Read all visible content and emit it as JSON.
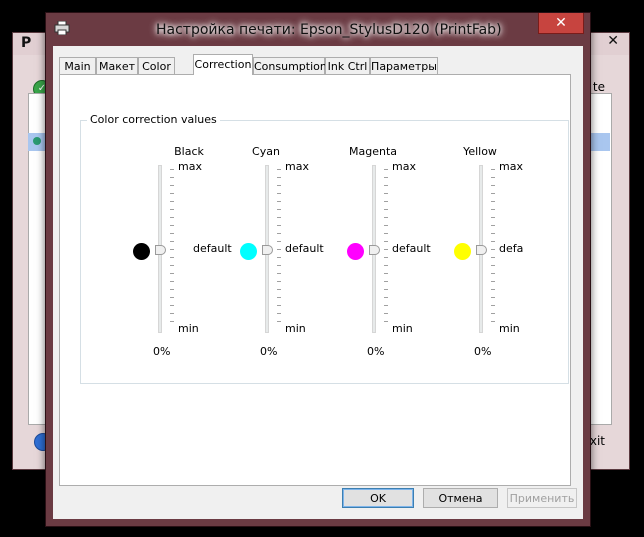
{
  "background_window": {
    "logo": "P",
    "close": "✕",
    "right_top_text": "te",
    "right_bottom_text": "xit"
  },
  "dialog": {
    "title": "Настройка печати: Epson_StylusD120 (PrintFab)",
    "close": "✕"
  },
  "tabs": [
    {
      "label": "Main"
    },
    {
      "label": "Макет"
    },
    {
      "label": "Color"
    },
    {
      "label": "Correction",
      "active": true
    },
    {
      "label": "Consumption"
    },
    {
      "label": "Ink Ctrl"
    },
    {
      "label": "Параметры"
    }
  ],
  "group": {
    "label": "Color correction values"
  },
  "channels": [
    {
      "name": "Black",
      "color": "#000000",
      "max": "max",
      "default": "default",
      "min": "min",
      "value": "0%"
    },
    {
      "name": "Cyan",
      "color": "#00ffff",
      "max": "max",
      "default": "default",
      "min": "min",
      "value": "0%"
    },
    {
      "name": "Magenta",
      "color": "#ff00ff",
      "max": "max",
      "default": "default",
      "min": "min",
      "value": "0%"
    },
    {
      "name": "Yellow",
      "color": "#ffff00",
      "max": "max",
      "default": "defa",
      "min": "min",
      "value": "0%"
    }
  ],
  "buttons": {
    "ok": "OK",
    "cancel": "Отмена",
    "apply": "Применить"
  },
  "colors": {
    "accent_frame": "#6b3b43",
    "close_button": "#c7443f",
    "selection": "#a9c6ef"
  }
}
